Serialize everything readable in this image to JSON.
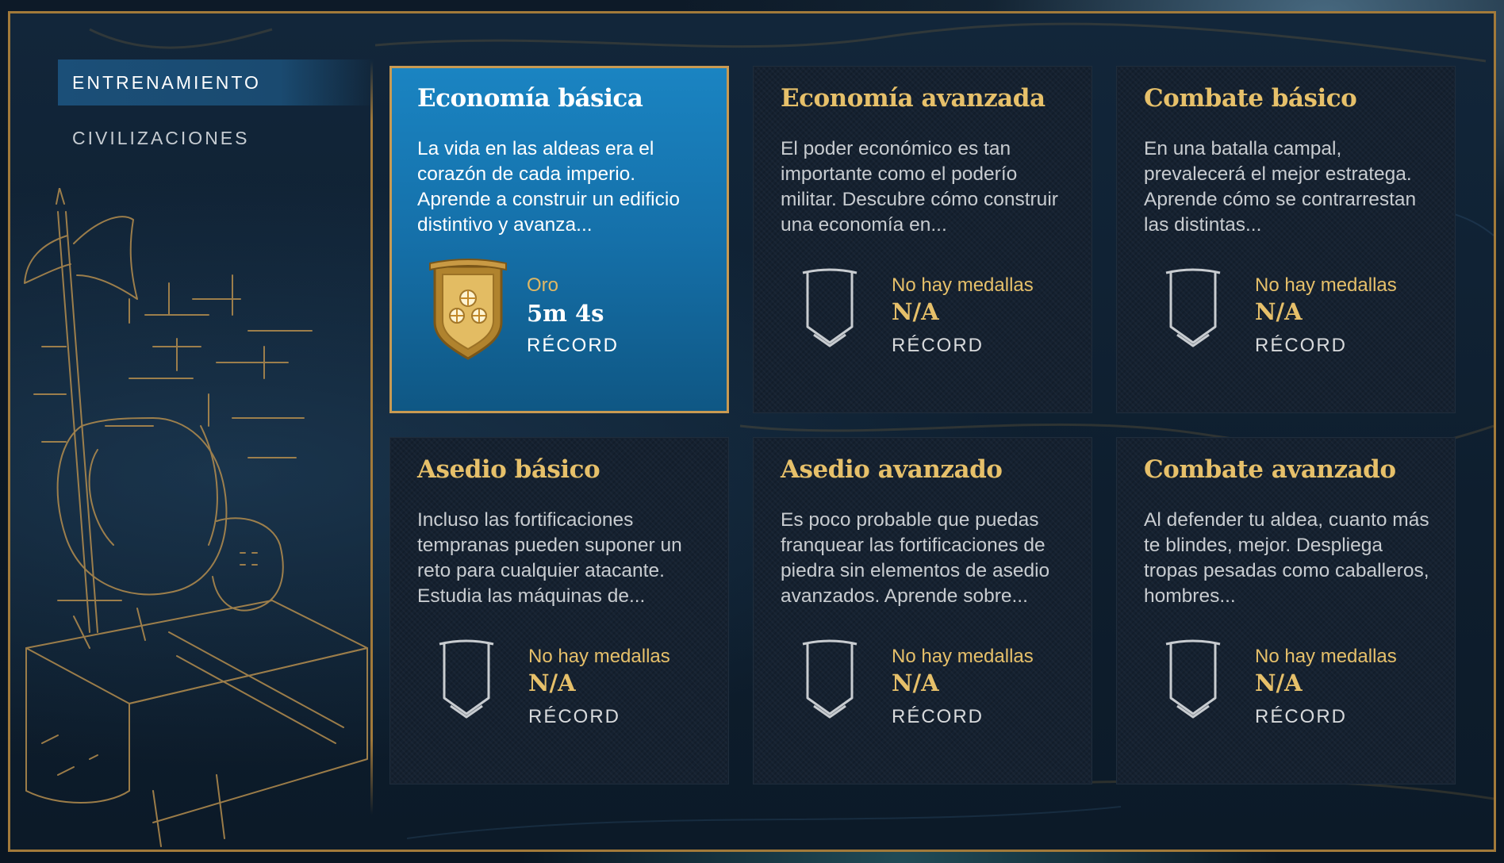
{
  "nav": {
    "items": [
      {
        "label": "ENTRENAMIENTO",
        "active": true
      },
      {
        "label": "CIVILIZACIONES",
        "active": false
      }
    ]
  },
  "cards": [
    {
      "title": "Economía básica",
      "description": "La vida en las aldeas era el corazón de cada imperio. Aprende a construir un edificio distintivo y avanza...",
      "medal_status": "Oro",
      "medal_value": "5m 4s",
      "record_label": "RÉCORD",
      "medal_icon": "gold-medal-icon",
      "selected": true
    },
    {
      "title": "Economía avanzada",
      "description": "El poder económico es tan importante como el poderío militar. Descubre cómo construir una economía en...",
      "medal_status": "No hay medallas",
      "medal_value": "N/A",
      "record_label": "RÉCORD",
      "medal_icon": "empty-banner-icon",
      "selected": false
    },
    {
      "title": "Combate básico",
      "description": "En una batalla campal, prevalecerá el mejor estratega. Aprende cómo se contrarrestan las distintas...",
      "medal_status": "No hay medallas",
      "medal_value": "N/A",
      "record_label": "RÉCORD",
      "medal_icon": "empty-banner-icon",
      "selected": false
    },
    {
      "title": "Asedio básico",
      "description": "Incluso las fortificaciones tempranas pueden suponer un reto para cualquier atacante. Estudia las máquinas de...",
      "medal_status": "No hay medallas",
      "medal_value": "N/A",
      "record_label": "RÉCORD",
      "medal_icon": "empty-banner-icon",
      "selected": false
    },
    {
      "title": "Asedio avanzado",
      "description": "Es poco probable que puedas franquear las fortificaciones de piedra sin elementos de asedio avanzados. Aprende sobre...",
      "medal_status": "No hay medallas",
      "medal_value": "N/A",
      "record_label": "RÉCORD",
      "medal_icon": "empty-banner-icon",
      "selected": false
    },
    {
      "title": "Combate avanzado",
      "description": "Al defender tu aldea, cuanto más te blindes, mejor. Despliega tropas pesadas como caballeros, hombres...",
      "medal_status": "No hay medallas",
      "medal_value": "N/A",
      "record_label": "RÉCORD",
      "medal_icon": "empty-banner-icon",
      "selected": false
    }
  ],
  "colors": {
    "gold": "#e6c06a",
    "frame": "#a27a3a",
    "selected_card": "#1a84c2",
    "card_bg": "#152130"
  }
}
